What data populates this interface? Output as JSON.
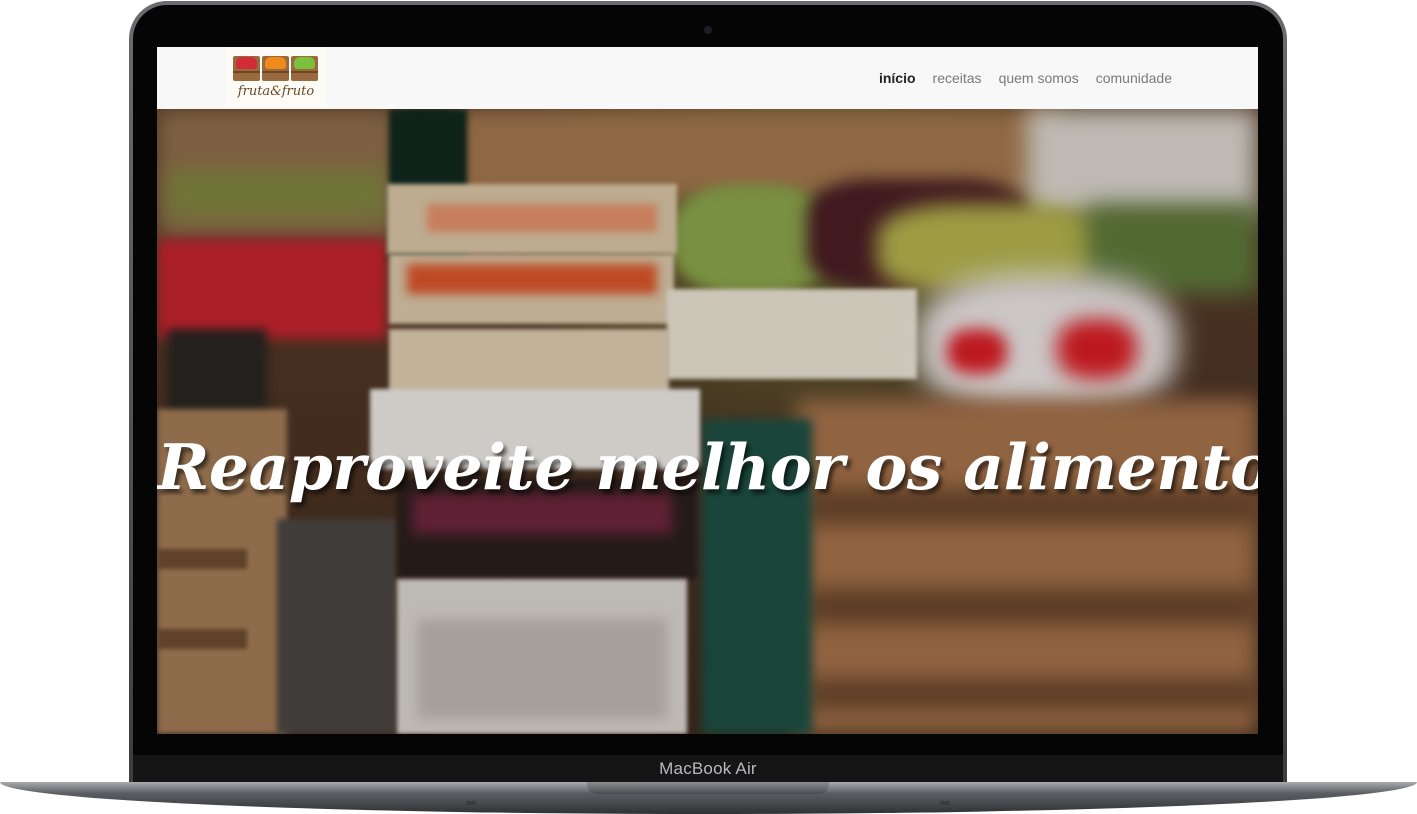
{
  "device": {
    "label": "MacBook Air"
  },
  "site": {
    "logo_text": "fruta&fruto",
    "logo_crate_colors": [
      "#d12c38",
      "#f08a1a",
      "#7cc03b"
    ]
  },
  "nav": {
    "items": [
      {
        "label": "início",
        "active": true
      },
      {
        "label": "receitas",
        "active": false
      },
      {
        "label": "quem somos",
        "active": false
      },
      {
        "label": "comunidade",
        "active": false
      }
    ]
  },
  "hero": {
    "headline": "Reaproveite melhor os alimentos!",
    "image_subject": "blurred market stall photo with crates of fruit"
  },
  "colors": {
    "navbar_bg": "#f8f8f8",
    "nav_active": "#222222",
    "nav_inactive": "#7a7a7a",
    "headline": "#ffffff"
  }
}
